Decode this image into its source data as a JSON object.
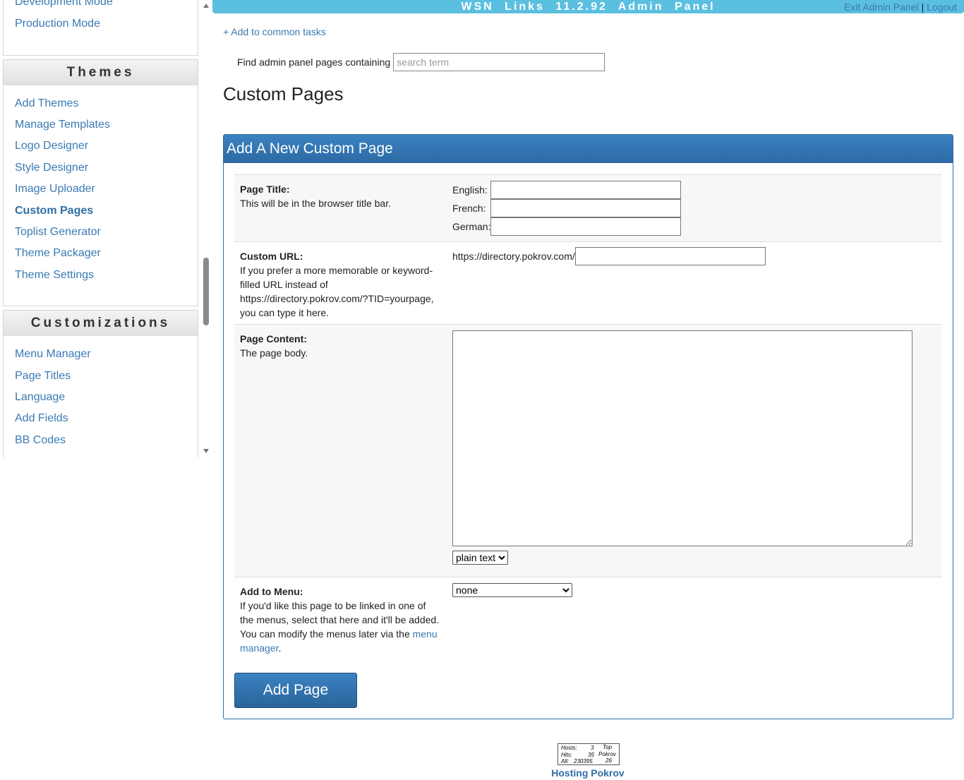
{
  "sidebar": {
    "partial_items": [
      "Development Mode",
      "Production Mode"
    ],
    "themes": {
      "header": "Themes",
      "items": [
        "Add Themes",
        "Manage Templates",
        "Logo Designer",
        "Style Designer",
        "Image Uploader",
        "Custom Pages",
        "Toplist Generator",
        "Theme Packager",
        "Theme Settings"
      ],
      "active": "Custom Pages"
    },
    "customizations": {
      "header": "Customizations",
      "items": [
        "Menu Manager",
        "Page Titles",
        "Language",
        "Add Fields",
        "BB Codes"
      ]
    }
  },
  "topbar": {
    "title": "WSN Links 11.2.92 Admin Panel",
    "exit_link": "Exit Admin Panel",
    "separator": "|",
    "logout_link": "Logout"
  },
  "common_tasks_link": "+ Add to common tasks",
  "search": {
    "label": "Find admin panel pages containing",
    "placeholder": "search term"
  },
  "page_title": "Custom Pages",
  "panel": {
    "header": "Add A New Custom Page",
    "page_title_field": {
      "label": "Page Title:",
      "description": "This will be in the browser title bar.",
      "languages": [
        "English:",
        "French:",
        "German:"
      ]
    },
    "custom_url_field": {
      "label": "Custom URL:",
      "description": "If you prefer a more memorable or keyword-filled URL instead of https://directory.pokrov.com/?TID=yourpage, you can type it here.",
      "prefix": "https://directory.pokrov.com/"
    },
    "page_content_field": {
      "label": "Page Content:",
      "description": "The page body.",
      "format_selected": "plain text"
    },
    "add_to_menu_field": {
      "label": "Add to Menu:",
      "description": "If you'd like this page to be linked in one of the menus, select that here and it'll be added. You can modify the menus later via the ",
      "link_text": "menu manager",
      "trailing": ".",
      "selected": "none"
    },
    "submit_label": "Add Page"
  },
  "footer": {
    "counter": {
      "hosts_label": "Hosts:",
      "hosts_value": "3",
      "hits_label": "Hits:",
      "hits_value": "35",
      "all_label": "All:",
      "all_value": "230395",
      "top_label": "Top",
      "brand": "Pokrov",
      "rank": "26"
    },
    "hosting_link": "Hosting Pokrov"
  }
}
